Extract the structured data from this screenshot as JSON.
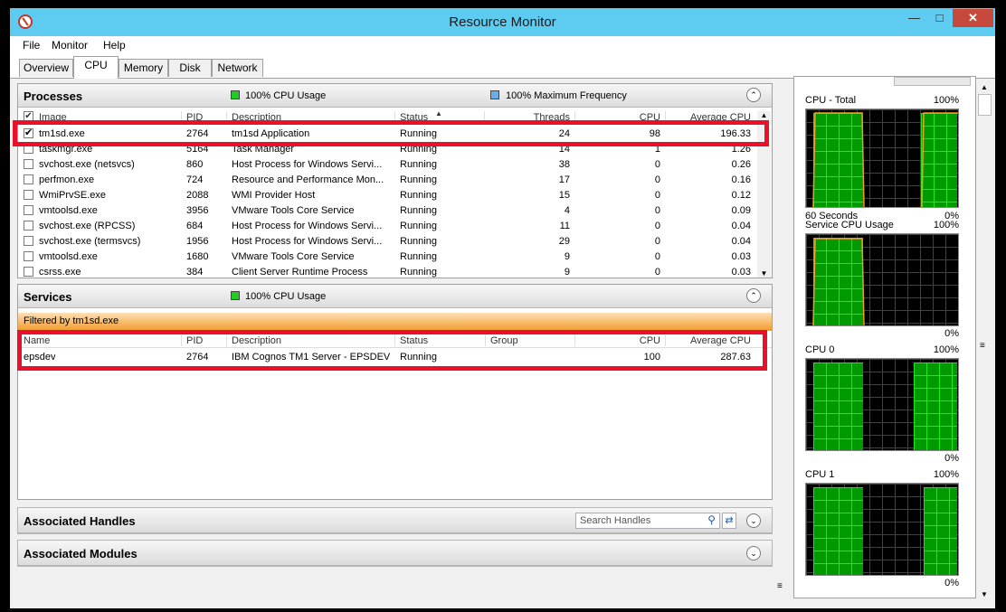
{
  "window": {
    "title": "Resource Monitor",
    "min": "—",
    "max": "□",
    "close": "✕"
  },
  "menu": [
    "File",
    "Monitor",
    "Help"
  ],
  "tabs": [
    "Overview",
    "CPU",
    "Memory",
    "Disk",
    "Network"
  ],
  "processes": {
    "title": "Processes",
    "legend1": "100% CPU Usage",
    "legend2": "100% Maximum Frequency",
    "legend1_color": "#22cc22",
    "legend2_color": "#6aaee8",
    "columns": [
      "Image",
      "PID",
      "Description",
      "Status",
      "Threads",
      "CPU",
      "Average CPU"
    ],
    "rows": [
      {
        "checked": "✔",
        "image": "tm1sd.exe",
        "pid": "2764",
        "desc": "tm1sd Application",
        "status": "Running",
        "threads": "24",
        "cpu": "98",
        "avg": "196.33"
      },
      {
        "checked": "",
        "image": "taskmgr.exe",
        "pid": "5164",
        "desc": "Task Manager",
        "status": "Running",
        "threads": "14",
        "cpu": "1",
        "avg": "1.26"
      },
      {
        "checked": "",
        "image": "svchost.exe (netsvcs)",
        "pid": "860",
        "desc": "Host Process for Windows Servi...",
        "status": "Running",
        "threads": "38",
        "cpu": "0",
        "avg": "0.26"
      },
      {
        "checked": "",
        "image": "perfmon.exe",
        "pid": "724",
        "desc": "Resource and Performance Mon...",
        "status": "Running",
        "threads": "17",
        "cpu": "0",
        "avg": "0.16"
      },
      {
        "checked": "",
        "image": "WmiPrvSE.exe",
        "pid": "2088",
        "desc": "WMI Provider Host",
        "status": "Running",
        "threads": "15",
        "cpu": "0",
        "avg": "0.12"
      },
      {
        "checked": "",
        "image": "vmtoolsd.exe",
        "pid": "3956",
        "desc": "VMware Tools Core Service",
        "status": "Running",
        "threads": "4",
        "cpu": "0",
        "avg": "0.09"
      },
      {
        "checked": "",
        "image": "svchost.exe (RPCSS)",
        "pid": "684",
        "desc": "Host Process for Windows Servi...",
        "status": "Running",
        "threads": "11",
        "cpu": "0",
        "avg": "0.04"
      },
      {
        "checked": "",
        "image": "svchost.exe (termsvcs)",
        "pid": "1956",
        "desc": "Host Process for Windows Servi...",
        "status": "Running",
        "threads": "29",
        "cpu": "0",
        "avg": "0.04"
      },
      {
        "checked": "",
        "image": "vmtoolsd.exe",
        "pid": "1680",
        "desc": "VMware Tools Core Service",
        "status": "Running",
        "threads": "9",
        "cpu": "0",
        "avg": "0.03"
      },
      {
        "checked": "",
        "image": "csrss.exe",
        "pid": "384",
        "desc": "Client Server Runtime Process",
        "status": "Running",
        "threads": "9",
        "cpu": "0",
        "avg": "0.03"
      }
    ]
  },
  "services": {
    "title": "Services",
    "legend1": "100% CPU Usage",
    "filter": "Filtered by tm1sd.exe",
    "columns": [
      "Name",
      "PID",
      "Description",
      "Status",
      "Group",
      "CPU",
      "Average CPU"
    ],
    "rows": [
      {
        "name": "epsdev",
        "pid": "2764",
        "desc": "IBM Cognos TM1 Server - EPSDEV",
        "status": "Running",
        "group": "",
        "cpu": "100",
        "avg": "287.63"
      }
    ]
  },
  "handles": {
    "title": "Associated Handles",
    "search_placeholder": "Search Handles"
  },
  "modules": {
    "title": "Associated Modules"
  },
  "graphs": [
    {
      "label": "CPU - Total",
      "top": "100%",
      "bottom_left": "60 Seconds",
      "bottom_right": "0%"
    },
    {
      "label": "Service CPU Usage",
      "top": "100%",
      "bottom_left": "",
      "bottom_right": "0%"
    },
    {
      "label": "CPU 0",
      "top": "100%",
      "bottom_left": "",
      "bottom_right": "0%"
    },
    {
      "label": "CPU 1",
      "top": "100%",
      "bottom_left": "",
      "bottom_right": "0%"
    }
  ],
  "accent_red": "#e8102a",
  "filter_bar_color": "#f7a23a"
}
